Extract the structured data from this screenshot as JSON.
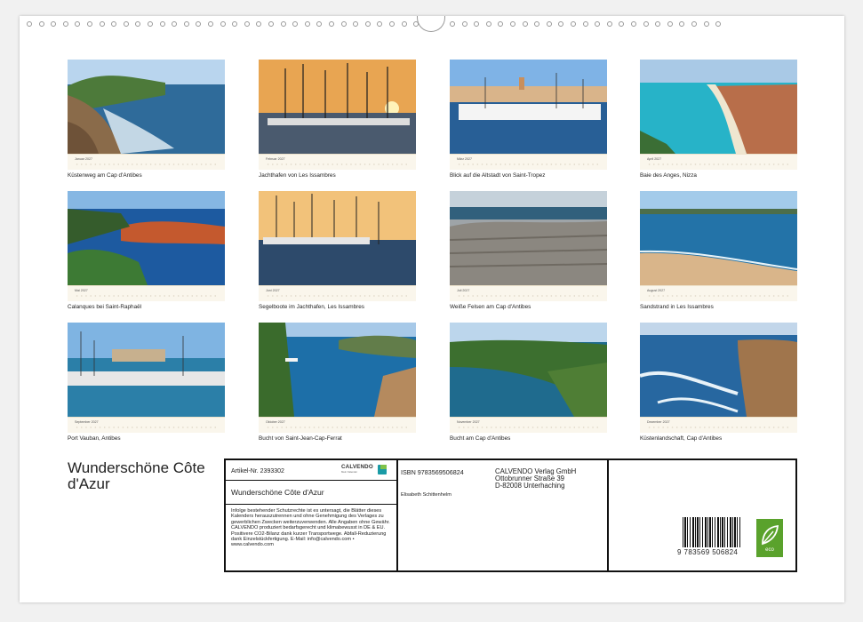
{
  "months": [
    {
      "month": "Januar 2027",
      "caption": "Küstenweg am Cap d'Antibes",
      "scene": "rocky-coast"
    },
    {
      "month": "Februar 2027",
      "caption": "Jachthafen von Les Issambres",
      "scene": "sunset-harbor"
    },
    {
      "month": "März 2027",
      "caption": "Blick auf die Altstadt von Saint-Tropez",
      "scene": "town-harbor"
    },
    {
      "month": "April 2027",
      "caption": "Baie des Anges, Nizza",
      "scene": "bay-city"
    },
    {
      "month": "Mai 2027",
      "caption": "Calanques bei Saint-Raphaël",
      "scene": "red-rocks"
    },
    {
      "month": "Juni 2027",
      "caption": "Segelboote im Jachthafen, Les Issambres",
      "scene": "marina-dusk"
    },
    {
      "month": "Juli 2027",
      "caption": "Weiße Felsen am Cap d'Antibes",
      "scene": "white-rocks"
    },
    {
      "month": "August 2027",
      "caption": "Sandstrand in Les Issambres",
      "scene": "beach"
    },
    {
      "month": "September 2027",
      "caption": "Port Vauban, Antibes",
      "scene": "port"
    },
    {
      "month": "Oktober 2027",
      "caption": "Bucht von Saint-Jean-Cap-Ferrat",
      "scene": "cape-view"
    },
    {
      "month": "November 2027",
      "caption": "Bucht am Cap d'Antibes",
      "scene": "green-cove"
    },
    {
      "month": "Dezember 2027",
      "caption": "Küstenlandschaft, Cap d'Antibes",
      "scene": "cliff-waves"
    }
  ],
  "back_cover": {
    "title": "Wunderschöne Côte d'Azur",
    "article": "Artikel-Nr. 2393302",
    "calendar_name": "Wunderschöne Côte d'Azur",
    "isbn": "ISBN 9783569506824",
    "author": "Elisabeth Schittenhelm",
    "publisher_name": "CALVENDO Verlag GmbH",
    "publisher_street": "Ottobrunner Straße 39",
    "publisher_city": "D-82008 Unterhaching",
    "legal_text": "Infolge bestehender Schutzrechte ist es untersagt, die Blätter dieses Kalenders herauszutrennen und ohne Genehmigung des Verlages zu gewerblichen Zwecken weiterzuverwenden. Alle Angaben ohne Gewähr. CALVENDO produziert bedarfsgerecht und klimabewusst in DE & EU. Positivere CO2-Bilanz dank kurzer Transportwege. Abfall-Reduzierung dank Einzelstückfertigung. E-Mail: info@calvendo.com • www.calvendo.com",
    "barcode_number": "9 783569 506824",
    "logo_text": "CALVENDO",
    "logo_subtext": "Mein Kalender",
    "eco_label": "eco",
    "accent_teal": "#1a9ba6",
    "eco_green": "#5aa22c"
  }
}
